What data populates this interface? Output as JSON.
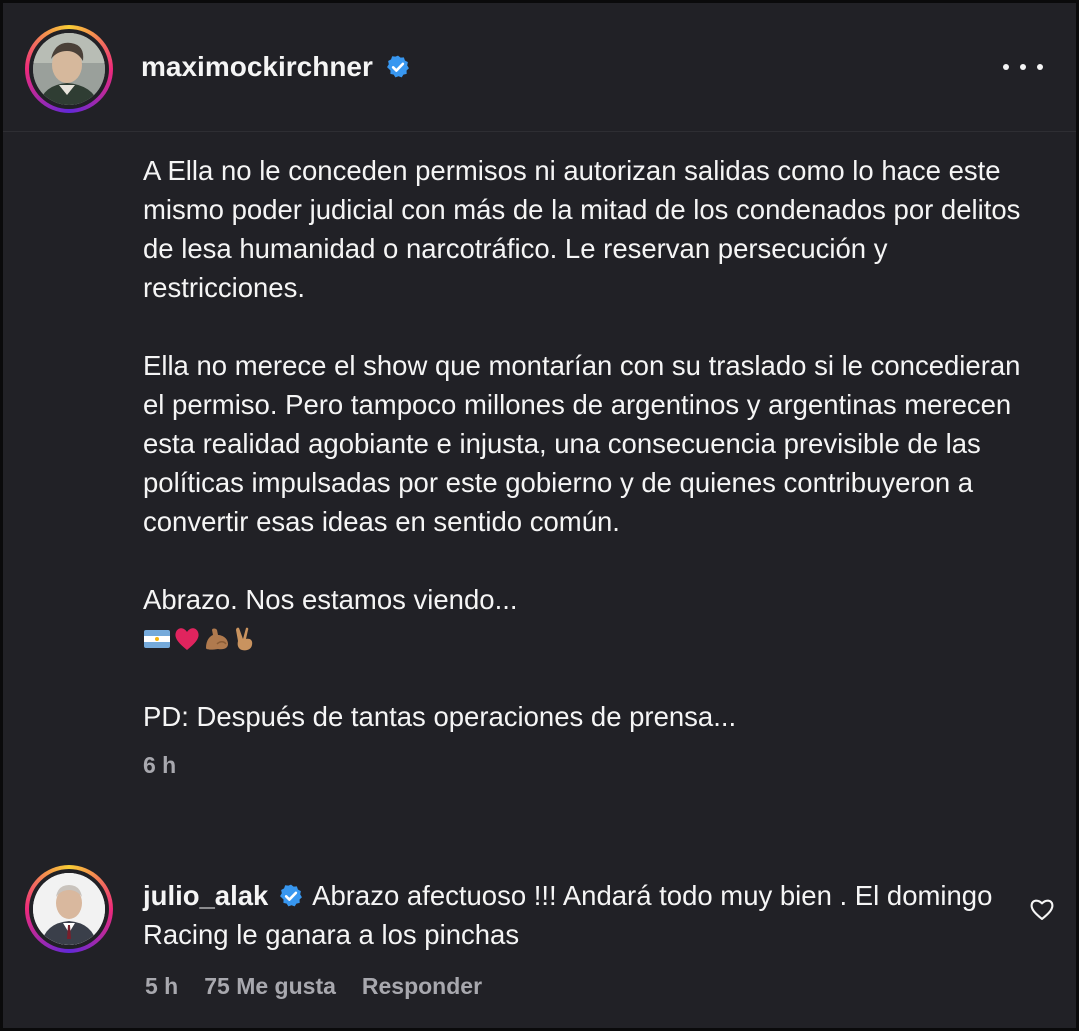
{
  "post": {
    "username": "maximockirchner",
    "verified": true,
    "more_icon": "more-horizontal-icon",
    "paragraphs": [
      "A Ella no le conceden permisos ni autorizan salidas como lo hace este mismo poder judicial con más de la mitad de los condenados por delitos de lesa humanidad o narcotráfico. Le reservan persecución y restricciones.",
      "Ella no merece el show que montarían con su traslado si le concedieran el permiso. Pero tampoco millones de argentinos y argentinas merecen esta realidad agobiante e injusta, una consecuencia previsible de las políticas impulsadas por este gobierno y de quienes contribuyeron a convertir esas ideas en sentido común.",
      "Abrazo. Nos estamos viendo...",
      "PD: Después de tantas operaciones de prensa..."
    ],
    "emojis": [
      "argentina-flag-icon",
      "red-heart-icon",
      "flexed-biceps-icon",
      "victory-hand-icon"
    ],
    "time": "6 h"
  },
  "comment": {
    "username": "julio_alak",
    "verified": true,
    "text": "Abrazo afectuoso !!! Andará todo muy bien . El domingo Racing le ganara a los pinchas",
    "time": "5 h",
    "likes": "75 Me gusta",
    "reply_label": "Responder",
    "like_icon": "heart-outline-icon"
  },
  "colors": {
    "background": "#212126",
    "text": "#f5f5f5",
    "muted": "#a8a8ae",
    "verified_blue": "#3897f0",
    "heart_red": "#e0245e"
  }
}
